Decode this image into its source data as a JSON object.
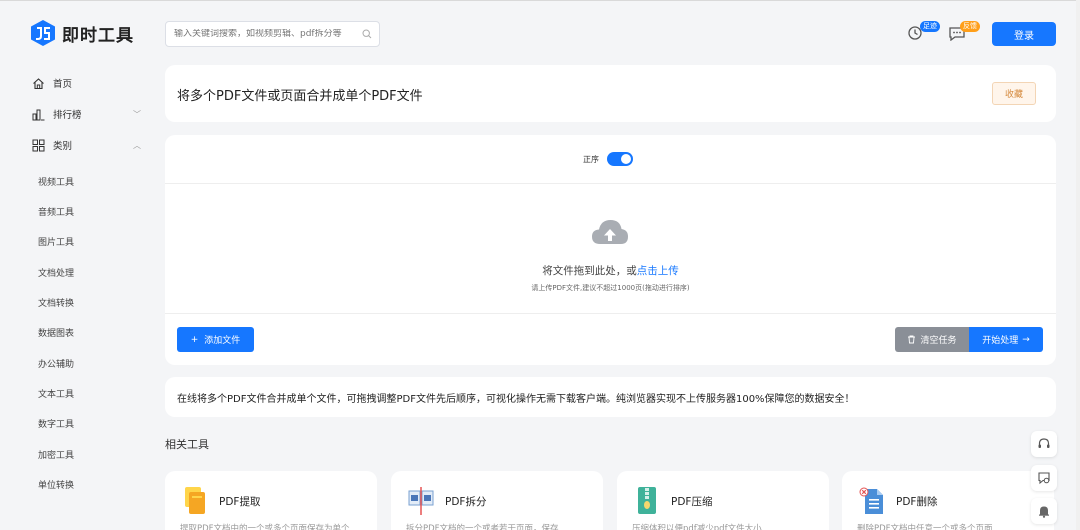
{
  "header": {
    "brand": "即时工具",
    "search_placeholder": "输入关键词搜索，如视频剪辑、pdf拆分等",
    "badge_recent": "足迹",
    "badge_feedback": "反馈",
    "login_label": "登录"
  },
  "sidebar": {
    "home": "首页",
    "ranking": "排行榜",
    "category": "类别",
    "sub_items": [
      "视频工具",
      "音频工具",
      "图片工具",
      "文档处理",
      "文档转换",
      "数据图表",
      "办公辅助",
      "文本工具",
      "数字工具",
      "加密工具",
      "单位转换"
    ]
  },
  "main": {
    "title": "将多个PDF文件或页面合并成单个PDF文件",
    "favorite_label": "收藏",
    "order_label": "正序",
    "drop_text": "将文件拖到此处，或",
    "drop_link": "点击上传",
    "drop_hint": "请上传PDF文件,建议不超过1000页(拖动进行排序)",
    "add_file_label": "添加文件",
    "clear_label": "清空任务",
    "start_label": "开始处理",
    "description": "在线将多个PDF文件合并成单个文件，可拖拽调整PDF文件先后顺序，可视化操作无需下载客户端。纯浏览器实现不上传服务器100%保障您的数据安全！",
    "related_title": "相关工具"
  },
  "related_tools": [
    {
      "name": "PDF提取",
      "desc": "提取PDF文档中的一个或多个页面保存为单个",
      "icon": "pdf-extract-icon"
    },
    {
      "name": "PDF拆分",
      "desc": "拆分PDF文档的一个或者若干页面，保存",
      "icon": "pdf-split-icon"
    },
    {
      "name": "PDF压缩",
      "desc": "压缩体积以便pdf减少pdf文件大小",
      "icon": "pdf-compress-icon"
    },
    {
      "name": "PDF删除",
      "desc": "删除PDF文档中任意一个或多个页面",
      "icon": "pdf-delete-icon"
    }
  ],
  "colors": {
    "accent": "#1677ff",
    "orange": "#ff9f1a",
    "gray_button": "#8a8f97"
  }
}
